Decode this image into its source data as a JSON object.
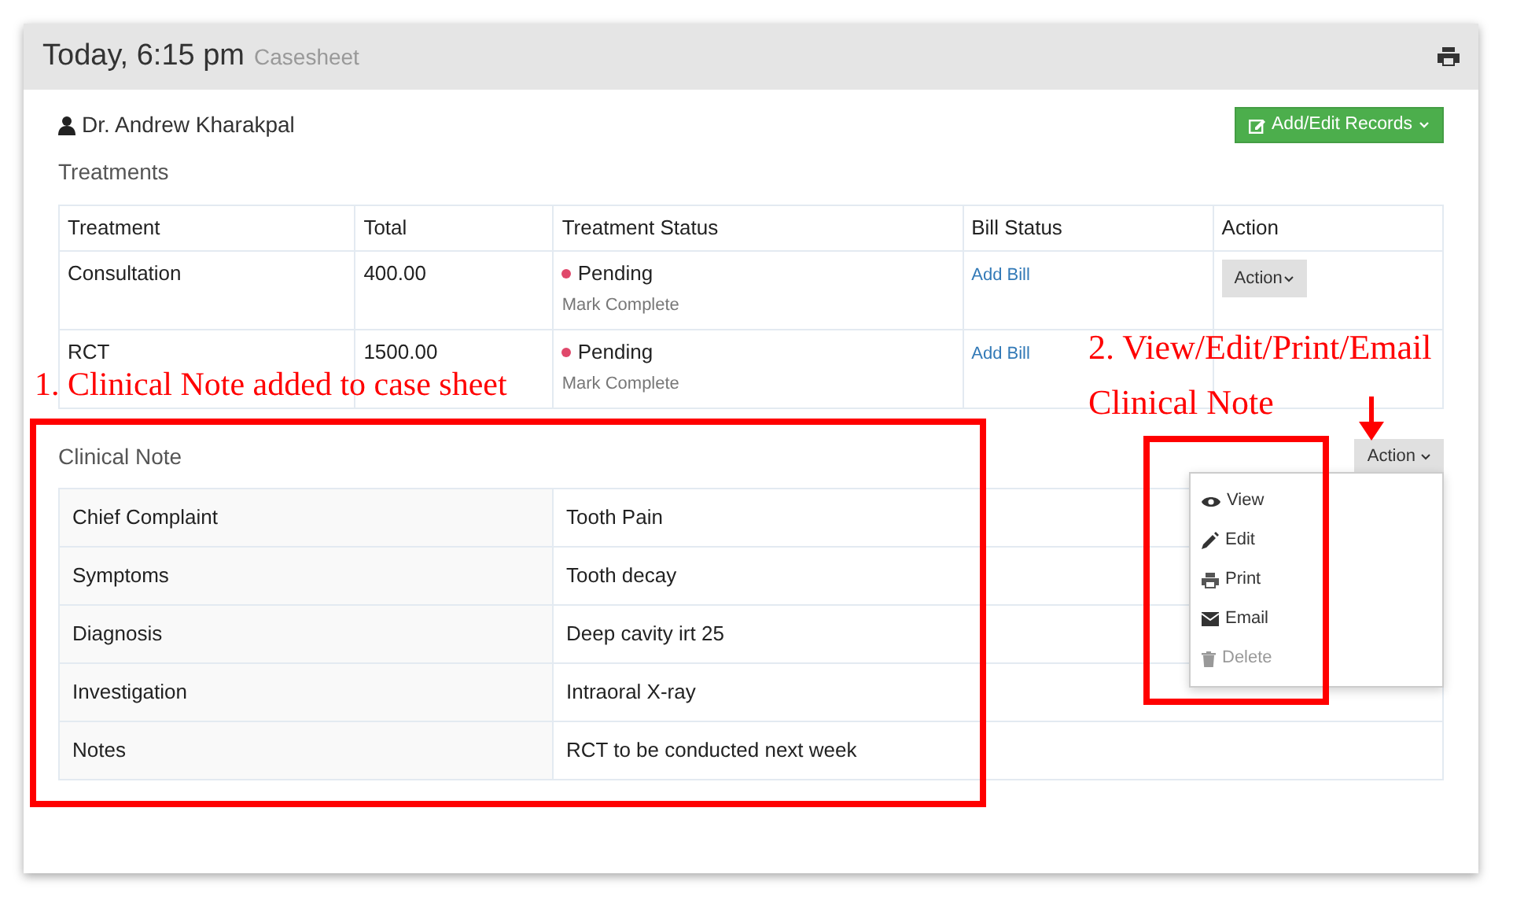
{
  "header": {
    "title": "Today, 6:15 pm",
    "subtitle": "Casesheet"
  },
  "doctor": "Dr. Andrew Kharakpal",
  "add_edit_button": "Add/Edit Records",
  "treatments": {
    "heading": "Treatments",
    "columns": [
      "Treatment",
      "Total",
      "Treatment Status",
      "Bill Status",
      "Action"
    ],
    "rows": [
      {
        "treatment": "Consultation",
        "total": "400.00",
        "status": "Pending",
        "color": "#e0486b",
        "mark_complete": "Mark Complete",
        "bill": "Add Bill",
        "action": "Action"
      },
      {
        "treatment": "RCT",
        "total": "1500.00",
        "status": "Pending",
        "color": "#e0486b",
        "mark_complete": "Mark Complete",
        "bill": "Add Bill"
      }
    ]
  },
  "clinical_note": {
    "heading": "Clinical Note",
    "action_button": "Action",
    "menu": [
      {
        "label": "View",
        "disabled": false
      },
      {
        "label": "Edit",
        "disabled": false
      },
      {
        "label": "Print",
        "disabled": false
      },
      {
        "label": "Email",
        "disabled": false
      },
      {
        "label": "Delete",
        "disabled": true
      }
    ],
    "rows": [
      {
        "label": "Chief Complaint",
        "value": "Tooth Pain"
      },
      {
        "label": "Symptoms",
        "value": "Tooth decay"
      },
      {
        "label": "Diagnosis",
        "value": "Deep cavity irt 25"
      },
      {
        "label": "Investigation",
        "value": "Intraoral X-ray"
      },
      {
        "label": "Notes",
        "value": "RCT to be conducted next week"
      }
    ]
  },
  "annotations": [
    "1. Clinical Note added to case sheet",
    "2. View/Edit/Print/Email",
    "Clinical Note"
  ]
}
